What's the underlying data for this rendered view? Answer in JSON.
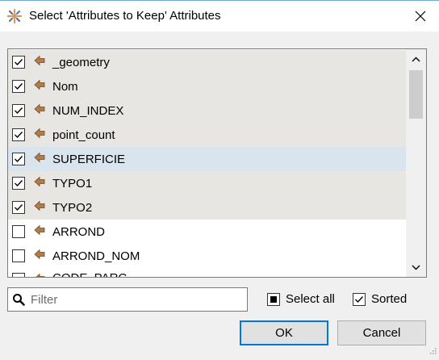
{
  "window": {
    "title": "Select 'Attributes to Keep' Attributes"
  },
  "attributes": [
    {
      "name": "_geometry",
      "checked": true,
      "selected": false
    },
    {
      "name": "Nom",
      "checked": true,
      "selected": false
    },
    {
      "name": "NUM_INDEX",
      "checked": true,
      "selected": false
    },
    {
      "name": "point_count",
      "checked": true,
      "selected": false
    },
    {
      "name": "SUPERFICIE",
      "checked": true,
      "selected": true
    },
    {
      "name": "TYPO1",
      "checked": true,
      "selected": false
    },
    {
      "name": "TYPO2",
      "checked": true,
      "selected": false
    },
    {
      "name": "ARROND",
      "checked": false,
      "selected": false
    },
    {
      "name": "ARROND_NOM",
      "checked": false,
      "selected": false
    },
    {
      "name": "CODE_PARC",
      "checked": false,
      "selected": false
    }
  ],
  "filter": {
    "placeholder": "Filter",
    "value": ""
  },
  "options": {
    "select_all_label": "Select all",
    "select_all_state": "partial",
    "sorted_label": "Sorted",
    "sorted_checked": true
  },
  "buttons": {
    "ok": "OK",
    "cancel": "Cancel"
  },
  "icons": {
    "app": "fme-workbench-icon",
    "attribute": "attribute-arrow-icon",
    "close": "close-icon",
    "search": "search-icon"
  },
  "colors": {
    "accent": "#0078d7",
    "checked_row": "#e8e6e3",
    "selected_row": "#d9e4ef",
    "attribute_icon": "#b07d4a"
  }
}
